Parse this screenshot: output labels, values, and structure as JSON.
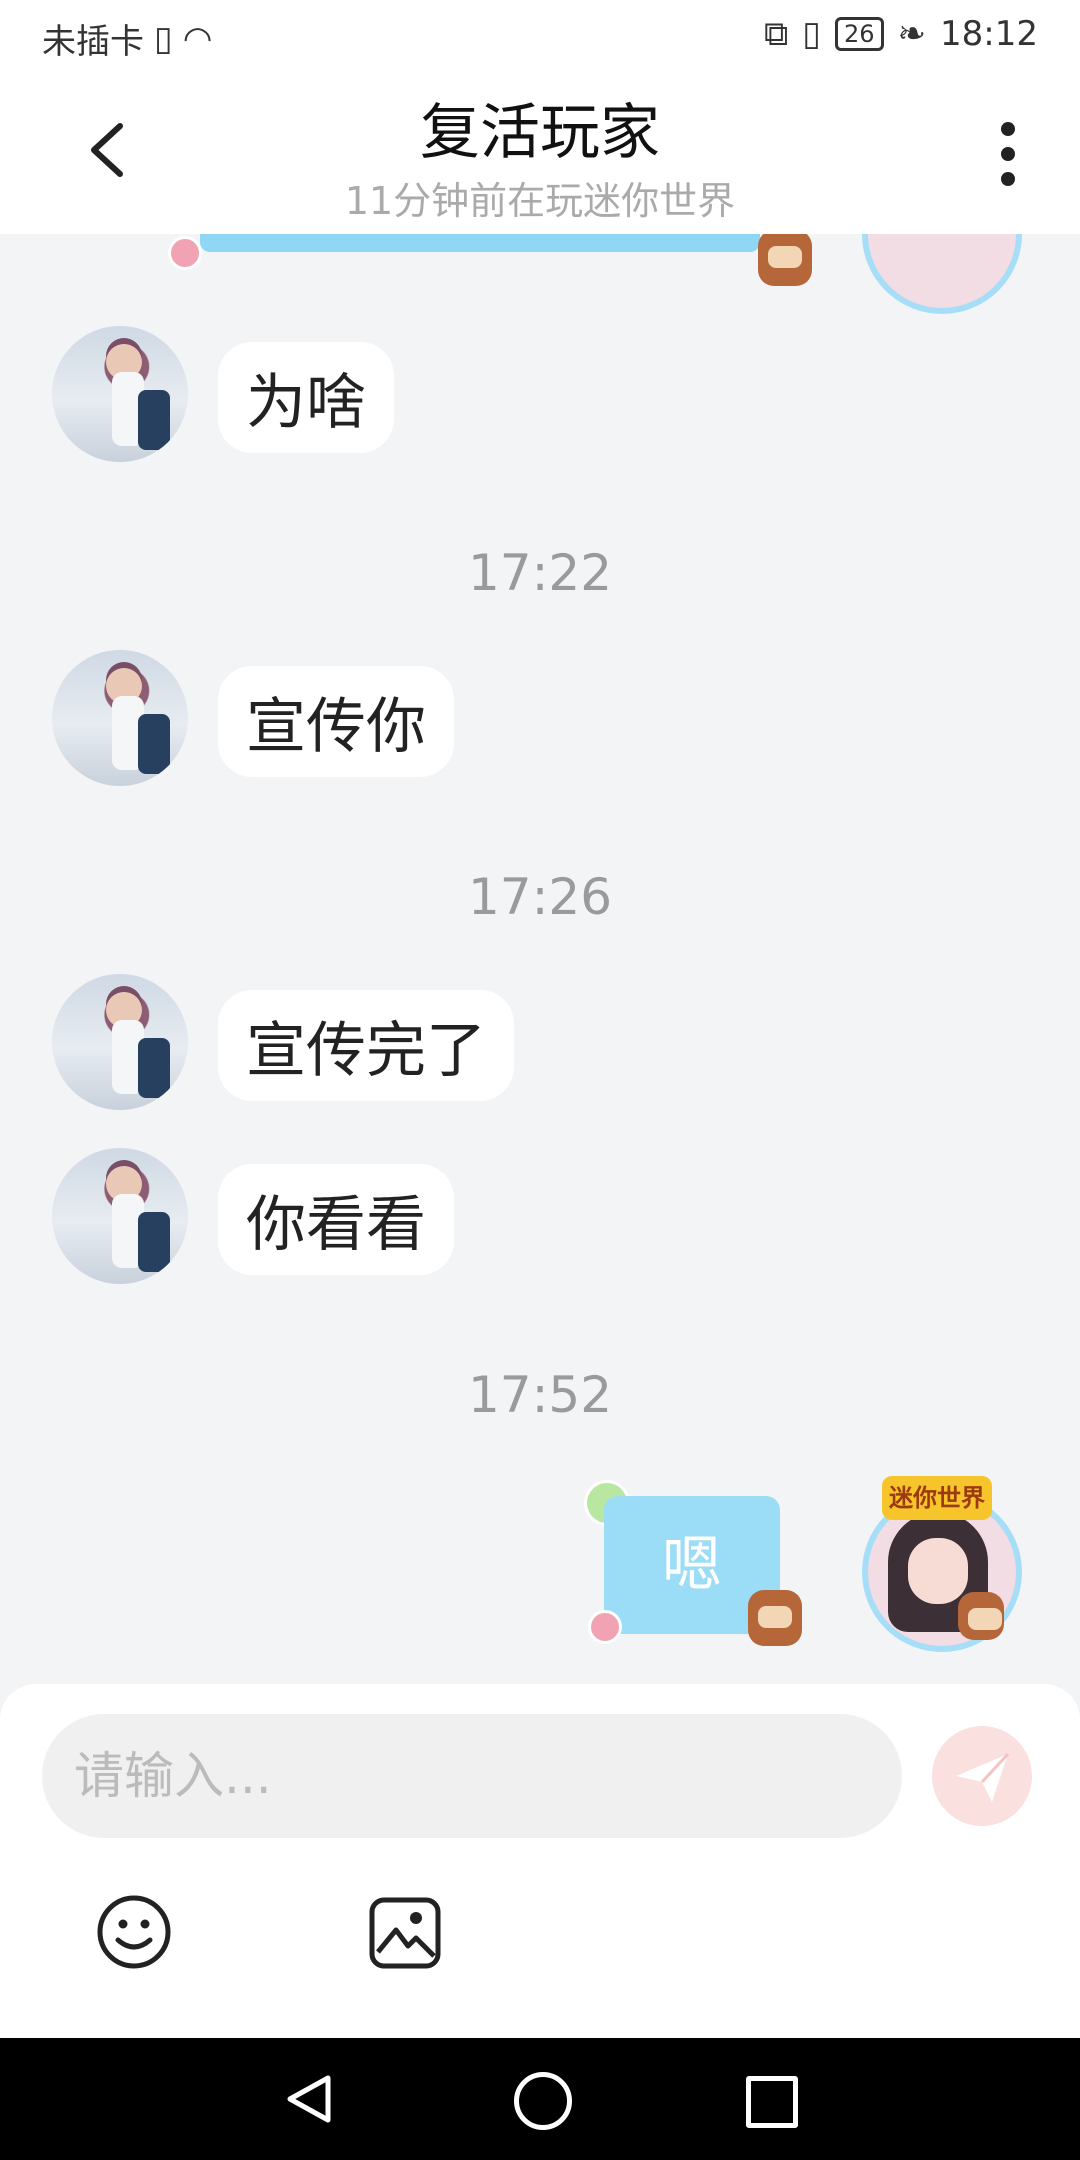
{
  "status_bar": {
    "carrier": "未插卡",
    "battery": "26",
    "time": "18:12"
  },
  "header": {
    "title": "复活玩家",
    "subtitle": "11分钟前在玩迷你世界"
  },
  "messages": [
    {
      "text": "为啥"
    },
    {
      "time": "17:22"
    },
    {
      "text": "宣传你"
    },
    {
      "time": "17:26"
    },
    {
      "text": "宣传完了"
    },
    {
      "text": "你看看"
    },
    {
      "time": "17:52"
    },
    {
      "sent_text": "嗯"
    }
  ],
  "sender_badge": "迷你世界",
  "input": {
    "placeholder": "请输入..."
  },
  "colors": {
    "background": "#f3f4f6",
    "sent_bubble": "#9bdcf7",
    "send_button": "#fbe0e0"
  }
}
